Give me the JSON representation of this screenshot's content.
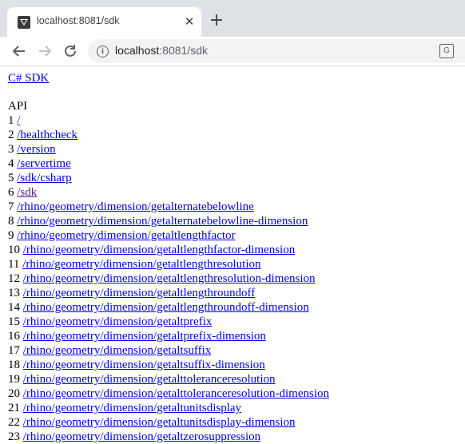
{
  "browser": {
    "tab_title": "localhost:8081/sdk",
    "close_glyph": "✕",
    "newtab_glyph": "+",
    "url_host": "localhost",
    "url_path": ":8081/sdk",
    "icons": [
      "favicon-icon",
      "close-icon",
      "new-tab-icon",
      "back-icon",
      "forward-icon",
      "reload-icon",
      "site-info-icon",
      "translate-icon"
    ]
  },
  "page": {
    "sdk_link": "C# SDK",
    "api_title": "API",
    "endpoints": [
      {
        "n": "1",
        "path": "/",
        "visited": true
      },
      {
        "n": "2",
        "path": "/healthcheck",
        "visited": false
      },
      {
        "n": "3",
        "path": "/version",
        "visited": false
      },
      {
        "n": "4",
        "path": "/servertime",
        "visited": false
      },
      {
        "n": "5",
        "path": "/sdk/csharp",
        "visited": false
      },
      {
        "n": "6",
        "path": "/sdk",
        "visited": true
      },
      {
        "n": "7",
        "path": "/rhino/geometry/dimension/getalternatebelowline",
        "visited": false
      },
      {
        "n": "8",
        "path": "/rhino/geometry/dimension/getalternatebelowline-dimension",
        "visited": false
      },
      {
        "n": "9",
        "path": "/rhino/geometry/dimension/getaltlengthfactor",
        "visited": false
      },
      {
        "n": "10",
        "path": "/rhino/geometry/dimension/getaltlengthfactor-dimension",
        "visited": false
      },
      {
        "n": "11",
        "path": "/rhino/geometry/dimension/getaltlengthresolution",
        "visited": false
      },
      {
        "n": "12",
        "path": "/rhino/geometry/dimension/getaltlengthresolution-dimension",
        "visited": false
      },
      {
        "n": "13",
        "path": "/rhino/geometry/dimension/getaltlengthroundoff",
        "visited": false
      },
      {
        "n": "14",
        "path": "/rhino/geometry/dimension/getaltlengthroundoff-dimension",
        "visited": false
      },
      {
        "n": "15",
        "path": "/rhino/geometry/dimension/getaltprefix",
        "visited": false
      },
      {
        "n": "16",
        "path": "/rhino/geometry/dimension/getaltprefix-dimension",
        "visited": false
      },
      {
        "n": "17",
        "path": "/rhino/geometry/dimension/getaltsuffix",
        "visited": false
      },
      {
        "n": "18",
        "path": "/rhino/geometry/dimension/getaltsuffix-dimension",
        "visited": false
      },
      {
        "n": "19",
        "path": "/rhino/geometry/dimension/getalttoleranceresolution",
        "visited": false
      },
      {
        "n": "20",
        "path": "/rhino/geometry/dimension/getalttoleranceresolution-dimension",
        "visited": false
      },
      {
        "n": "21",
        "path": "/rhino/geometry/dimension/getaltunitsdisplay",
        "visited": false
      },
      {
        "n": "22",
        "path": "/rhino/geometry/dimension/getaltunitsdisplay-dimension",
        "visited": false
      },
      {
        "n": "23",
        "path": "/rhino/geometry/dimension/getaltzerosuppression",
        "visited": false
      }
    ]
  },
  "colors": {
    "link": "#0000ee",
    "visited": "#551a8b",
    "tabstrip": "#dee1e6"
  }
}
